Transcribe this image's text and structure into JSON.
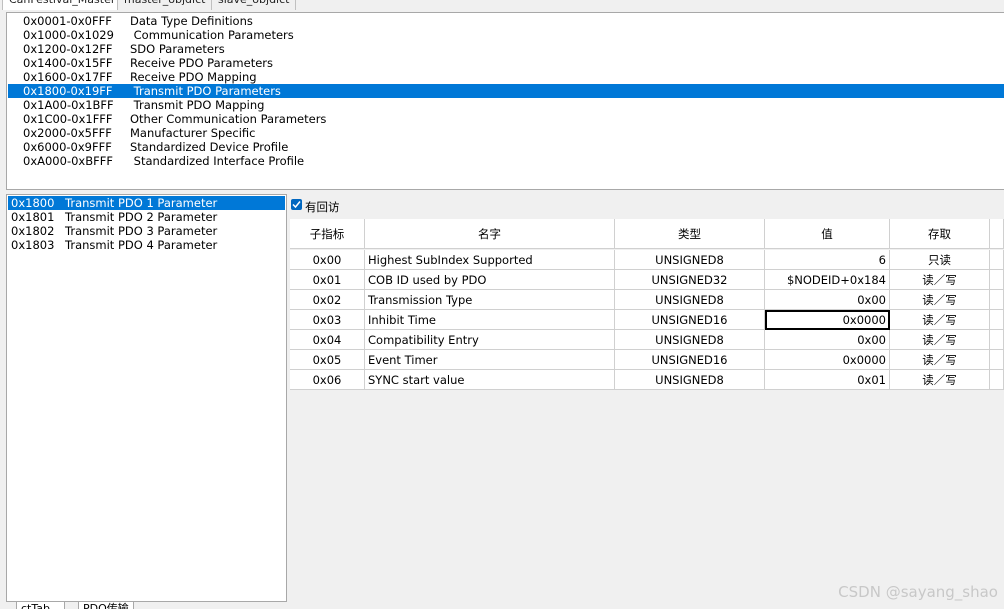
{
  "tabs": [
    "CanFestival_Master",
    "master_objdict",
    "slave_objdict"
  ],
  "ranges": [
    {
      "range": "0x0001-0x0FFF",
      "name": "Data Type Definitions"
    },
    {
      "range": "0x1000-0x1029",
      "name": " Communication Parameters"
    },
    {
      "range": "0x1200-0x12FF",
      "name": "SDO Parameters"
    },
    {
      "range": "0x1400-0x15FF",
      "name": "Receive PDO Parameters"
    },
    {
      "range": "0x1600-0x17FF",
      "name": "Receive PDO Mapping"
    },
    {
      "range": "0x1800-0x19FF",
      "name": " Transmit PDO Parameters"
    },
    {
      "range": "0x1A00-0x1BFF",
      "name": " Transmit PDO Mapping"
    },
    {
      "range": "0x1C00-0x1FFF",
      "name": "Other Communication Parameters"
    },
    {
      "range": "0x2000-0x5FFF",
      "name": "Manufacturer Specific"
    },
    {
      "range": "0x6000-0x9FFF",
      "name": "Standardized Device Profile"
    },
    {
      "range": "0xA000-0xBFFF",
      "name": " Standardized Interface Profile"
    }
  ],
  "selected_range_index": 5,
  "entries": [
    {
      "index": "0x1800",
      "name": "Transmit PDO 1 Parameter"
    },
    {
      "index": "0x1801",
      "name": "Transmit PDO 2 Parameter"
    },
    {
      "index": "0x1802",
      "name": "Transmit PDO 3 Parameter"
    },
    {
      "index": "0x1803",
      "name": "Transmit PDO 4 Parameter"
    }
  ],
  "selected_entry_index": 0,
  "bottom_tabs": [
    "ctTab...",
    "PDO传输"
  ],
  "callback_label": "有回访",
  "columns": [
    "子指标",
    "名字",
    "类型",
    "值",
    "存取"
  ],
  "rows": [
    {
      "sub": "0x00",
      "name": "Highest SubIndex Supported",
      "type": "UNSIGNED8",
      "value": "6",
      "access": "只读"
    },
    {
      "sub": "0x01",
      "name": "COB ID used by PDO",
      "type": "UNSIGNED32",
      "value": "$NODEID+0x184",
      "access": "读／写"
    },
    {
      "sub": "0x02",
      "name": "Transmission Type",
      "type": "UNSIGNED8",
      "value": "0x00",
      "access": "读／写"
    },
    {
      "sub": "0x03",
      "name": "Inhibit Time",
      "type": "UNSIGNED16",
      "value": "0x0000",
      "access": "读／写"
    },
    {
      "sub": "0x04",
      "name": "Compatibility Entry",
      "type": "UNSIGNED8",
      "value": "0x00",
      "access": "读／写"
    },
    {
      "sub": "0x05",
      "name": "Event Timer",
      "type": "UNSIGNED16",
      "value": "0x0000",
      "access": "读／写"
    },
    {
      "sub": "0x06",
      "name": "SYNC start value",
      "type": "UNSIGNED8",
      "value": "0x01",
      "access": "读／写"
    }
  ],
  "focused_row_index": 3,
  "watermark": "CSDN @sayang_shao",
  "colors": {
    "selection": "#0078d7",
    "checkbox": "#0067c0"
  }
}
